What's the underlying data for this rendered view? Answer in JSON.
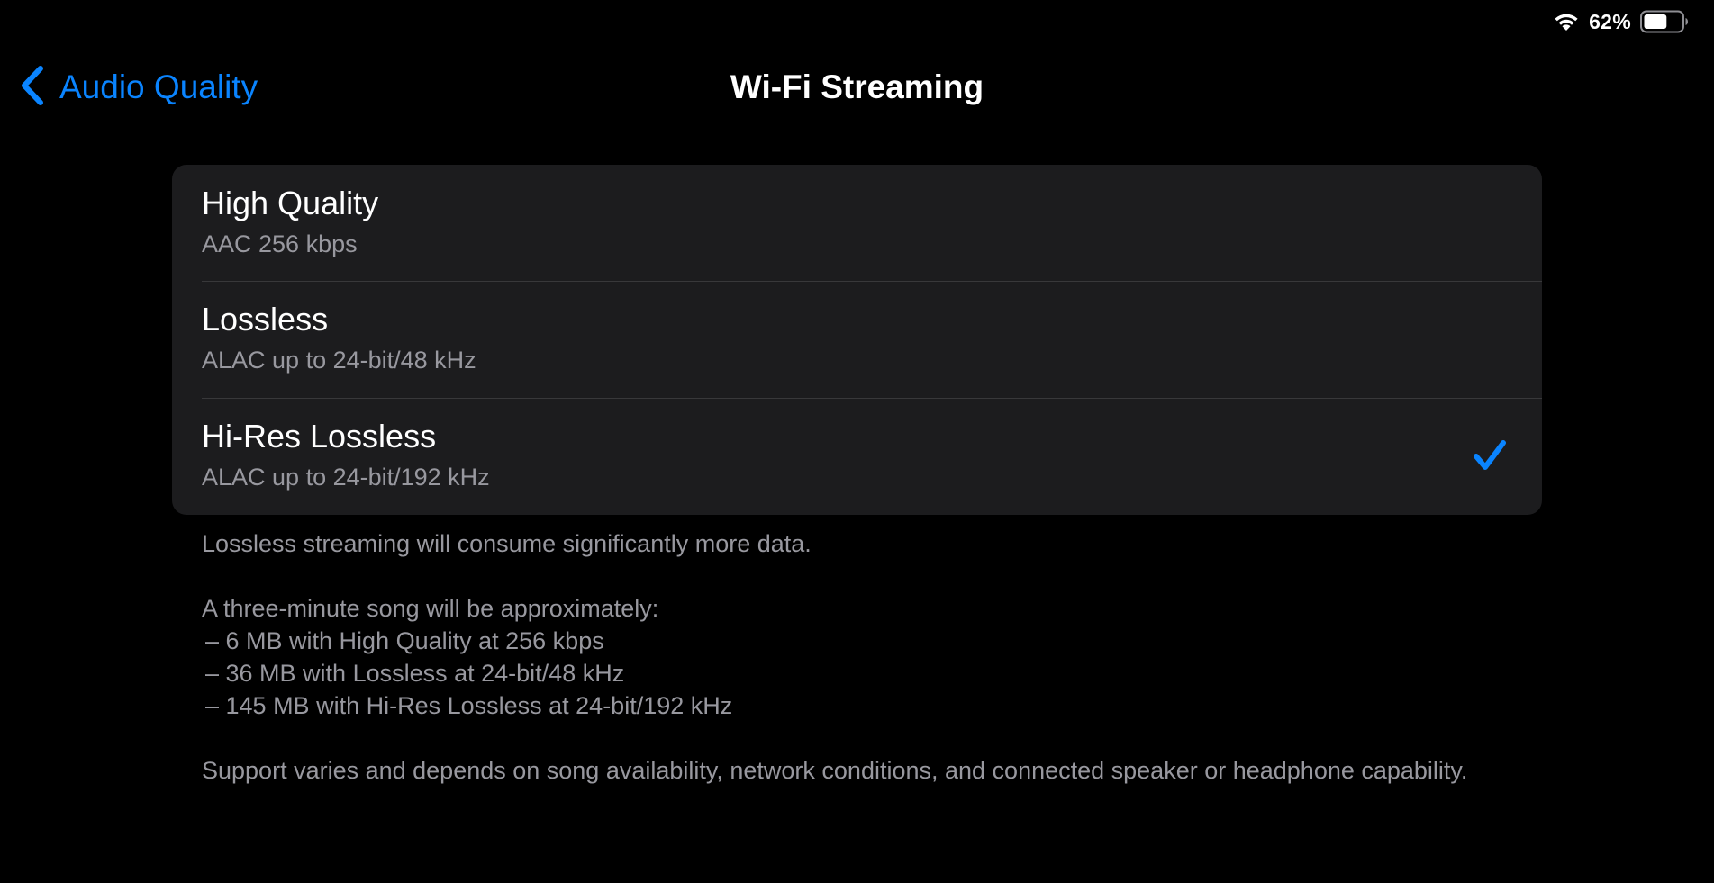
{
  "status_bar": {
    "battery_percent": "62%",
    "battery_level": 0.62,
    "icons": [
      "wifi-icon",
      "battery-icon"
    ]
  },
  "nav": {
    "back_label": "Audio Quality",
    "back_icon": "chevron-left-icon",
    "title": "Wi-Fi Streaming"
  },
  "options": [
    {
      "title": "High Quality",
      "subtitle": "AAC 256 kbps",
      "selected": false
    },
    {
      "title": "Lossless",
      "subtitle": "ALAC up to 24-bit/48 kHz",
      "selected": false
    },
    {
      "title": "Hi-Res Lossless",
      "subtitle": "ALAC up to 24-bit/192 kHz",
      "selected": true
    }
  ],
  "footer": {
    "data_note": "Lossless streaming will consume significantly more data.",
    "song_intro": "A three-minute song will be approximately:",
    "bullets": [
      " – 6 MB with High Quality at 256 kbps",
      " – 36 MB with Lossless at 24-bit/48 kHz",
      " – 145 MB with Hi-Res Lossless at 24-bit/192 kHz"
    ],
    "support_note": "Support varies and depends on song availability, network conditions, and connected speaker or headphone capability."
  },
  "colors": {
    "accent": "#0a84ff",
    "background": "#000000",
    "card": "#1c1c1e",
    "secondary_text": "#98989f"
  }
}
